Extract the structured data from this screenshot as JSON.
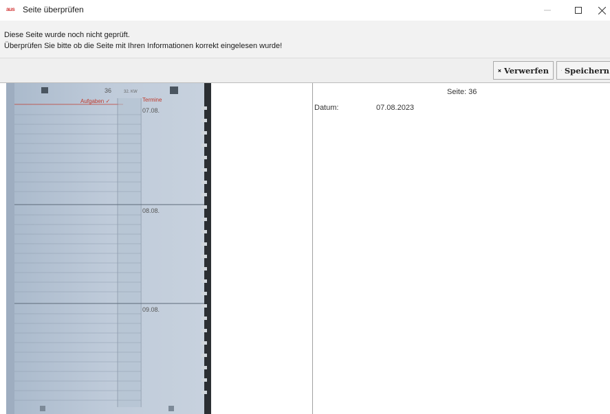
{
  "window": {
    "logo_text": "aus",
    "title": "Seite überprüfen"
  },
  "info": {
    "line1": "Diese Seite wurde noch nicht geprüft.",
    "line2": "Überprüfen Sie bitte ob die Seite mit Ihren Informationen korrekt eingelesen wurde!"
  },
  "toolbar": {
    "discard_label": "Verwerfen",
    "discard_icon": "close-x-icon",
    "save_label": "Speichern",
    "save_icon": "floppy-disk-icon"
  },
  "scan": {
    "page_number": "36",
    "week": "32. KW",
    "tasks_header": "Aufgaben ✓",
    "appointments_header": "Termine",
    "days": [
      "07.08.",
      "08.08.",
      "09.08."
    ],
    "accent_color": "#c0392b"
  },
  "detail": {
    "page_label": "Seite: 36",
    "date_label": "Datum:",
    "date_value": "07.08.2023"
  }
}
